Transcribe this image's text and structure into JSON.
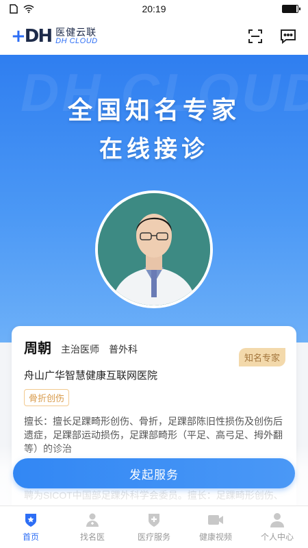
{
  "status_bar": {
    "time": "20:19",
    "battery_level": 0.9
  },
  "header": {
    "logo_mark": "DH",
    "brand_cn": "医健云联",
    "brand_en": "DH CLOUD",
    "scan_icon": "scan-icon",
    "message_icon": "chat-bubble-icon"
  },
  "hero": {
    "watermark": "DH CLOUD",
    "title_line1": "全国知名专家",
    "title_line2": "在线接诊"
  },
  "doctor": {
    "name": "周朝",
    "title": "主治医师",
    "department": "普外科",
    "badge": "知名专家",
    "hospital": "舟山广华智慧健康互联网医院",
    "tag": "骨折创伤",
    "specialty": "擅长：擅长足踝畸形创伤、骨折，足踝部陈旧性损伤及创伤后遗症，足踝部运动损伤，足踝部畸形（平足、高弓足、拇外翻等）的诊治",
    "intro": "简介：研究生毕业于江西中医药大学，师从舟山著名骨伤专家习；曾在上海第六人民医院深造学习足踝外科。2018年7月被聘为SICOT中国部足踝外科学会委员。擅长：足踝畸形创伤、"
  },
  "cta": {
    "label": "发起服务"
  },
  "tabs": [
    {
      "label": "首页",
      "icon": "home-shield-icon",
      "active": true
    },
    {
      "label": "找名医",
      "icon": "doctor-icon",
      "active": false
    },
    {
      "label": "医疗服务",
      "icon": "medical-cross-icon",
      "active": false
    },
    {
      "label": "健康视频",
      "icon": "video-icon",
      "active": false
    },
    {
      "label": "个人中心",
      "icon": "person-icon",
      "active": false
    }
  ],
  "colors": {
    "brand_blue": "#2d6ef5",
    "badge_gold": "#f3d9ab",
    "tag_orange": "#d89b4b",
    "inactive_gray": "#999999"
  }
}
